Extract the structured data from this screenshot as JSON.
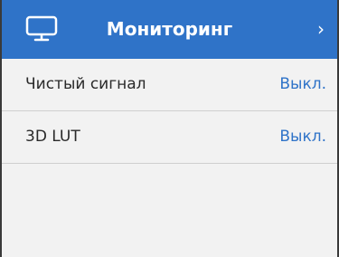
{
  "header": {
    "icon": "monitor-icon",
    "title": "Мониторинг",
    "chevron": "›"
  },
  "settings": [
    {
      "label": "Чистый сигнал",
      "value": "Выкл."
    },
    {
      "label": "3D LUT",
      "value": "Выкл."
    }
  ],
  "colors": {
    "accent": "#2f73c8",
    "background": "#f2f2f2",
    "text": "#2a2a2a"
  }
}
